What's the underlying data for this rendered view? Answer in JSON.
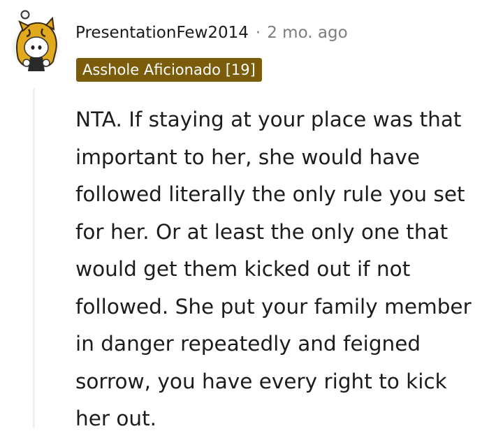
{
  "comment": {
    "author": "PresentationFew2014",
    "separator": "·",
    "timestamp": "2 mo. ago",
    "flair": {
      "text": "Asshole Aficionado [19]",
      "background_color": "#7a5c0a",
      "text_color": "#ffffff"
    },
    "avatar_icon": "snoo-avatar-icon",
    "body": "NTA. If staying at your place was that important to her, she would have followed literally the only rule you set for her. Or at least the only one that would get them kicked out if not followed. She put your family member in danger repeatedly and feigned sorrow, you have every right to kick her out."
  },
  "colors": {
    "meta_gray": "#7c7c7c",
    "thread_line": "#edeff1",
    "text": "#1c1c1c"
  }
}
